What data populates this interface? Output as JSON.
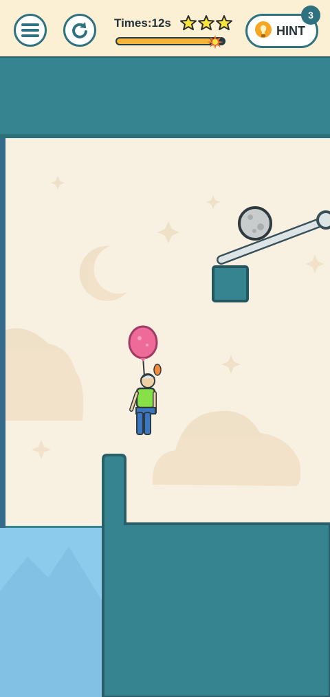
{
  "hud": {
    "menu_icon": "hamburger-menu-icon",
    "restart_icon": "restart-arrow-icon",
    "timer_text": "Times:12s",
    "stars_earned": 3,
    "progress_fraction": 0.88,
    "hint_label": "HINT",
    "hint_count": "3",
    "hint_icon": "lightbulb-icon"
  },
  "colors": {
    "teal_wall": "#36848f",
    "sky": "#f8f1e2",
    "water": "#8ccbec",
    "balloon": "#ee6a99",
    "star": "#f7e43c"
  },
  "scene": {
    "objects": [
      "stone-ball",
      "pin-rod",
      "square-block",
      "balloon-man",
      "pillar",
      "water"
    ]
  }
}
